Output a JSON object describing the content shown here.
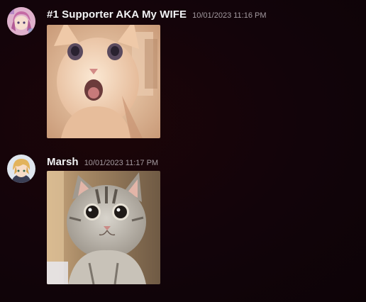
{
  "messages": [
    {
      "author": "#1 Supporter AKA My WIFE",
      "timestamp": "10/01/2023 11:16 PM",
      "attachment": "image-attachment",
      "avatar": "avatar-pink-anime"
    },
    {
      "author": "Marsh",
      "timestamp": "10/01/2023 11:17 PM",
      "attachment": "image-attachment",
      "avatar": "avatar-blond-anime"
    }
  ],
  "colors": {
    "background": "#12040a",
    "username": "#f2f3f5",
    "timestamp": "#a39aa0"
  }
}
